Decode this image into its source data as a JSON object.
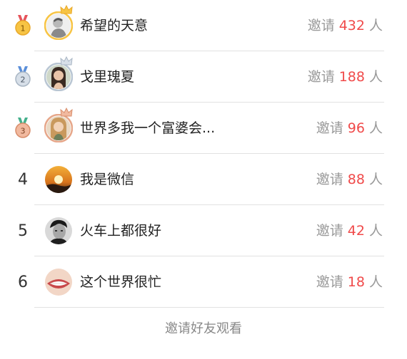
{
  "colors": {
    "gold": "#f7c444",
    "silver": "#b9c6d3",
    "bronze": "#e6a78a",
    "count_red": "#f04a4a",
    "muted_text": "#999999",
    "divider": "#e2e2e2"
  },
  "ranking": [
    {
      "rank": "1",
      "medal": "gold-medal-icon",
      "crown": "gold-crown-icon",
      "name": "希望的天意",
      "invite_prefix": "邀请",
      "count": "432",
      "invite_suffix": "人"
    },
    {
      "rank": "2",
      "medal": "silver-medal-icon",
      "crown": "silver-crown-icon",
      "name": "戈里瑰夏",
      "invite_prefix": "邀请",
      "count": "188",
      "invite_suffix": "人"
    },
    {
      "rank": "3",
      "medal": "bronze-medal-icon",
      "crown": "bronze-crown-icon",
      "name": "世界多我一个富婆会...",
      "invite_prefix": "邀请",
      "count": "96",
      "invite_suffix": "人"
    },
    {
      "rank": "4",
      "name": "我是微信",
      "invite_prefix": "邀请",
      "count": "88",
      "invite_suffix": "人"
    },
    {
      "rank": "5",
      "name": "火车上都很好",
      "invite_prefix": "邀请",
      "count": "42",
      "invite_suffix": "人"
    },
    {
      "rank": "6",
      "name": "这个世界很忙",
      "invite_prefix": "邀请",
      "count": "18",
      "invite_suffix": "人"
    }
  ],
  "footer": {
    "link_label": "邀请好友观看"
  }
}
